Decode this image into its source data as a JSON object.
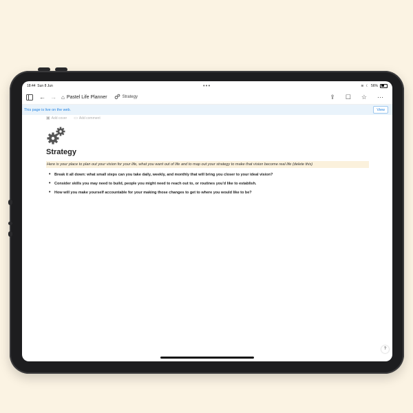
{
  "status_bar": {
    "time": "18:44",
    "date": "Sun 8 Jun",
    "dots": "•••",
    "battery": "56%",
    "battery_level": 0.56
  },
  "navbar": {
    "breadcrumb_home": "Pastel Life Planner",
    "breadcrumb_current": "Strategy"
  },
  "banner": {
    "text": "This page is live on the web.",
    "view_label": "View"
  },
  "page": {
    "add_cover": "Add cover",
    "add_comment": "Add comment",
    "title": "Strategy",
    "callout": "Here is your place to plan out your vision for your life, what you want out of life and to map out your strategy to make that vision become real life (delete this)",
    "bullets": [
      "Break it all down: what small steps can you take daily, weekly, and monthly that will bring you closer to your ideal vision?",
      "Consider skills you may need to build, people you might need to reach out to, or routines you'd like to establish.",
      "How will you make yourself accountable for your making those changes to get to where you would like to be?"
    ]
  },
  "help_label": "?",
  "colors": {
    "background": "#fbf3e3",
    "accent": "#2383e2",
    "callout": "#fbf1dc"
  }
}
